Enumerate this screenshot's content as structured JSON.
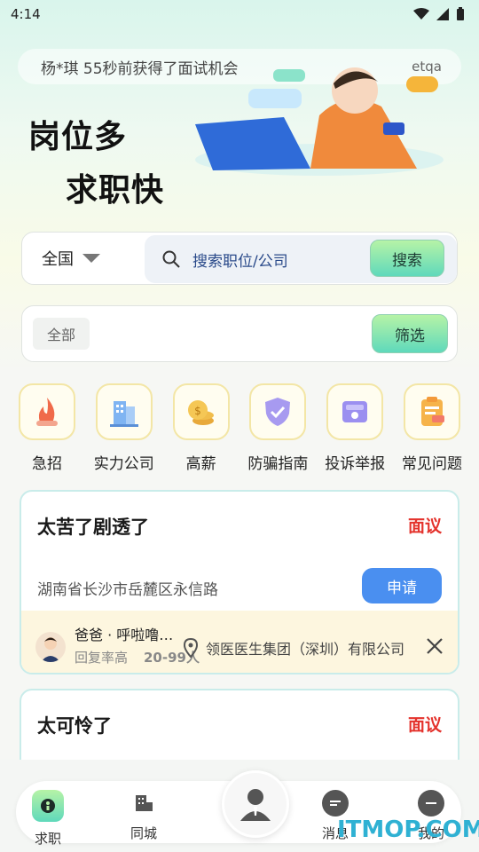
{
  "status": {
    "time": "4:14"
  },
  "notice": {
    "text": "杨*琪 55秒前获得了面试机会",
    "right": "etqa"
  },
  "hero": {
    "slogan_line1": "岗位多",
    "slogan_line2": "求职快"
  },
  "search": {
    "city": "全国",
    "placeholder": "搜索职位/公司",
    "button": "搜索"
  },
  "filter": {
    "tag": "全部",
    "button": "筛选"
  },
  "categories": [
    {
      "label": "急招",
      "icon": "fire-icon"
    },
    {
      "label": "实力公司",
      "icon": "building-icon"
    },
    {
      "label": "高薪",
      "icon": "coins-icon"
    },
    {
      "label": "防骗指南",
      "icon": "shield-icon"
    },
    {
      "label": "投诉举报",
      "icon": "report-icon"
    },
    {
      "label": "常见问题",
      "icon": "faq-icon"
    }
  ],
  "jobs": [
    {
      "title": "太苦了剧透了",
      "salary": "面议",
      "address": "湖南省长沙市岳麓区永信路",
      "apply": "申请",
      "recruiter": "爸爸 · 呼啦噜…",
      "reply": "回复率高",
      "staff": "20-99人",
      "company": "领医医生集团（深圳）有限公司"
    },
    {
      "title": "太可怜了",
      "salary": "面议"
    }
  ],
  "tabs": [
    {
      "label": "求职"
    },
    {
      "label": "同城"
    },
    {
      "label": "消息"
    },
    {
      "label": "我的"
    }
  ],
  "watermark": "ITMOP.COM",
  "colors": {
    "accent_green": "#5fd9bb",
    "salary_red": "#e4322c",
    "apply_blue": "#4a8ff0"
  }
}
